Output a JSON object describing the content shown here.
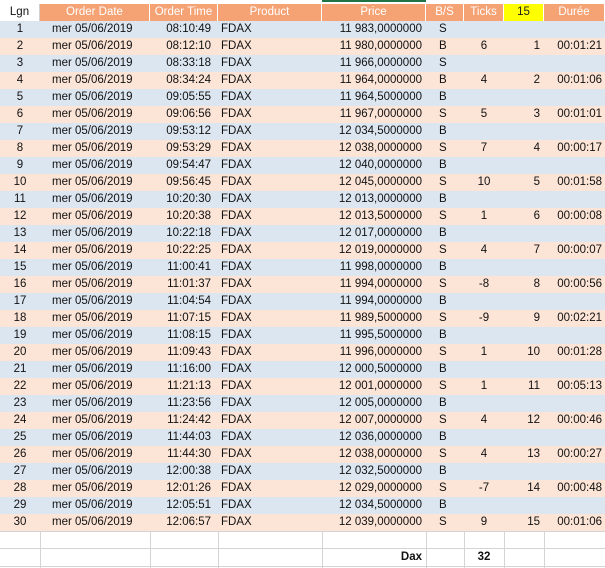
{
  "headers": {
    "lgn": "Lgn",
    "order_date": "Order Date",
    "order_time": "Order Time",
    "product": "Product",
    "price": "Price",
    "bs": "B/S",
    "ticks": "Ticks",
    "count": "15",
    "duree": "Durée"
  },
  "rows": [
    {
      "lgn": "1",
      "date": "mer 05/06/2019",
      "time": "08:10:49",
      "product": "FDAX",
      "price": "11 983,0000000",
      "bs": "S",
      "ticks": "",
      "n": "",
      "duree": ""
    },
    {
      "lgn": "2",
      "date": "mer 05/06/2019",
      "time": "08:12:10",
      "product": "FDAX",
      "price": "11 980,0000000",
      "bs": "B",
      "ticks": "6",
      "n": "1",
      "duree": "00:01:21"
    },
    {
      "lgn": "3",
      "date": "mer 05/06/2019",
      "time": "08:33:18",
      "product": "FDAX",
      "price": "11 966,0000000",
      "bs": "S",
      "ticks": "",
      "n": "",
      "duree": ""
    },
    {
      "lgn": "4",
      "date": "mer 05/06/2019",
      "time": "08:34:24",
      "product": "FDAX",
      "price": "11 964,0000000",
      "bs": "B",
      "ticks": "4",
      "n": "2",
      "duree": "00:01:06"
    },
    {
      "lgn": "5",
      "date": "mer 05/06/2019",
      "time": "09:05:55",
      "product": "FDAX",
      "price": "11 964,5000000",
      "bs": "B",
      "ticks": "",
      "n": "",
      "duree": ""
    },
    {
      "lgn": "6",
      "date": "mer 05/06/2019",
      "time": "09:06:56",
      "product": "FDAX",
      "price": "11 967,0000000",
      "bs": "S",
      "ticks": "5",
      "n": "3",
      "duree": "00:01:01"
    },
    {
      "lgn": "7",
      "date": "mer 05/06/2019",
      "time": "09:53:12",
      "product": "FDAX",
      "price": "12 034,5000000",
      "bs": "B",
      "ticks": "",
      "n": "",
      "duree": ""
    },
    {
      "lgn": "8",
      "date": "mer 05/06/2019",
      "time": "09:53:29",
      "product": "FDAX",
      "price": "12 038,0000000",
      "bs": "S",
      "ticks": "7",
      "n": "4",
      "duree": "00:00:17"
    },
    {
      "lgn": "9",
      "date": "mer 05/06/2019",
      "time": "09:54:47",
      "product": "FDAX",
      "price": "12 040,0000000",
      "bs": "B",
      "ticks": "",
      "n": "",
      "duree": ""
    },
    {
      "lgn": "10",
      "date": "mer 05/06/2019",
      "time": "09:56:45",
      "product": "FDAX",
      "price": "12 045,0000000",
      "bs": "S",
      "ticks": "10",
      "n": "5",
      "duree": "00:01:58"
    },
    {
      "lgn": "11",
      "date": "mer 05/06/2019",
      "time": "10:20:30",
      "product": "FDAX",
      "price": "12 013,0000000",
      "bs": "B",
      "ticks": "",
      "n": "",
      "duree": ""
    },
    {
      "lgn": "12",
      "date": "mer 05/06/2019",
      "time": "10:20:38",
      "product": "FDAX",
      "price": "12 013,5000000",
      "bs": "S",
      "ticks": "1",
      "n": "6",
      "duree": "00:00:08"
    },
    {
      "lgn": "13",
      "date": "mer 05/06/2019",
      "time": "10:22:18",
      "product": "FDAX",
      "price": "12 017,0000000",
      "bs": "B",
      "ticks": "",
      "n": "",
      "duree": ""
    },
    {
      "lgn": "14",
      "date": "mer 05/06/2019",
      "time": "10:22:25",
      "product": "FDAX",
      "price": "12 019,0000000",
      "bs": "S",
      "ticks": "4",
      "n": "7",
      "duree": "00:00:07"
    },
    {
      "lgn": "15",
      "date": "mer 05/06/2019",
      "time": "11:00:41",
      "product": "FDAX",
      "price": "11 998,0000000",
      "bs": "B",
      "ticks": "",
      "n": "",
      "duree": ""
    },
    {
      "lgn": "16",
      "date": "mer 05/06/2019",
      "time": "11:01:37",
      "product": "FDAX",
      "price": "11 994,0000000",
      "bs": "S",
      "ticks": "-8",
      "n": "8",
      "duree": "00:00:56"
    },
    {
      "lgn": "17",
      "date": "mer 05/06/2019",
      "time": "11:04:54",
      "product": "FDAX",
      "price": "11 994,0000000",
      "bs": "B",
      "ticks": "",
      "n": "",
      "duree": ""
    },
    {
      "lgn": "18",
      "date": "mer 05/06/2019",
      "time": "11:07:15",
      "product": "FDAX",
      "price": "11 989,5000000",
      "bs": "S",
      "ticks": "-9",
      "n": "9",
      "duree": "00:02:21"
    },
    {
      "lgn": "19",
      "date": "mer 05/06/2019",
      "time": "11:08:15",
      "product": "FDAX",
      "price": "11 995,5000000",
      "bs": "B",
      "ticks": "",
      "n": "",
      "duree": ""
    },
    {
      "lgn": "20",
      "date": "mer 05/06/2019",
      "time": "11:09:43",
      "product": "FDAX",
      "price": "11 996,0000000",
      "bs": "S",
      "ticks": "1",
      "n": "10",
      "duree": "00:01:28"
    },
    {
      "lgn": "21",
      "date": "mer 05/06/2019",
      "time": "11:16:00",
      "product": "FDAX",
      "price": "12 000,5000000",
      "bs": "B",
      "ticks": "",
      "n": "",
      "duree": ""
    },
    {
      "lgn": "22",
      "date": "mer 05/06/2019",
      "time": "11:21:13",
      "product": "FDAX",
      "price": "12 001,0000000",
      "bs": "S",
      "ticks": "1",
      "n": "11",
      "duree": "00:05:13"
    },
    {
      "lgn": "23",
      "date": "mer 05/06/2019",
      "time": "11:23:56",
      "product": "FDAX",
      "price": "12 005,0000000",
      "bs": "B",
      "ticks": "",
      "n": "",
      "duree": ""
    },
    {
      "lgn": "24",
      "date": "mer 05/06/2019",
      "time": "11:24:42",
      "product": "FDAX",
      "price": "12 007,0000000",
      "bs": "S",
      "ticks": "4",
      "n": "12",
      "duree": "00:00:46"
    },
    {
      "lgn": "25",
      "date": "mer 05/06/2019",
      "time": "11:44:03",
      "product": "FDAX",
      "price": "12 036,0000000",
      "bs": "B",
      "ticks": "",
      "n": "",
      "duree": ""
    },
    {
      "lgn": "26",
      "date": "mer 05/06/2019",
      "time": "11:44:30",
      "product": "FDAX",
      "price": "12 038,0000000",
      "bs": "S",
      "ticks": "4",
      "n": "13",
      "duree": "00:00:27"
    },
    {
      "lgn": "27",
      "date": "mer 05/06/2019",
      "time": "12:00:38",
      "product": "FDAX",
      "price": "12 032,5000000",
      "bs": "B",
      "ticks": "",
      "n": "",
      "duree": ""
    },
    {
      "lgn": "28",
      "date": "mer 05/06/2019",
      "time": "12:01:26",
      "product": "FDAX",
      "price": "12 029,0000000",
      "bs": "S",
      "ticks": "-7",
      "n": "14",
      "duree": "00:00:48"
    },
    {
      "lgn": "29",
      "date": "mer 05/06/2019",
      "time": "12:05:51",
      "product": "FDAX",
      "price": "12 034,5000000",
      "bs": "B",
      "ticks": "",
      "n": "",
      "duree": ""
    },
    {
      "lgn": "30",
      "date": "mer 05/06/2019",
      "time": "12:06:57",
      "product": "FDAX",
      "price": "12 039,0000000",
      "bs": "S",
      "ticks": "9",
      "n": "15",
      "duree": "00:01:06"
    }
  ],
  "totals": {
    "label": "Dax",
    "ticks": "32"
  },
  "colors": {
    "header": "#f5a275",
    "highlight": "#ffff00",
    "row_blue": "#dce6f1",
    "row_orange": "#fce4d6",
    "selection": "#217346"
  }
}
